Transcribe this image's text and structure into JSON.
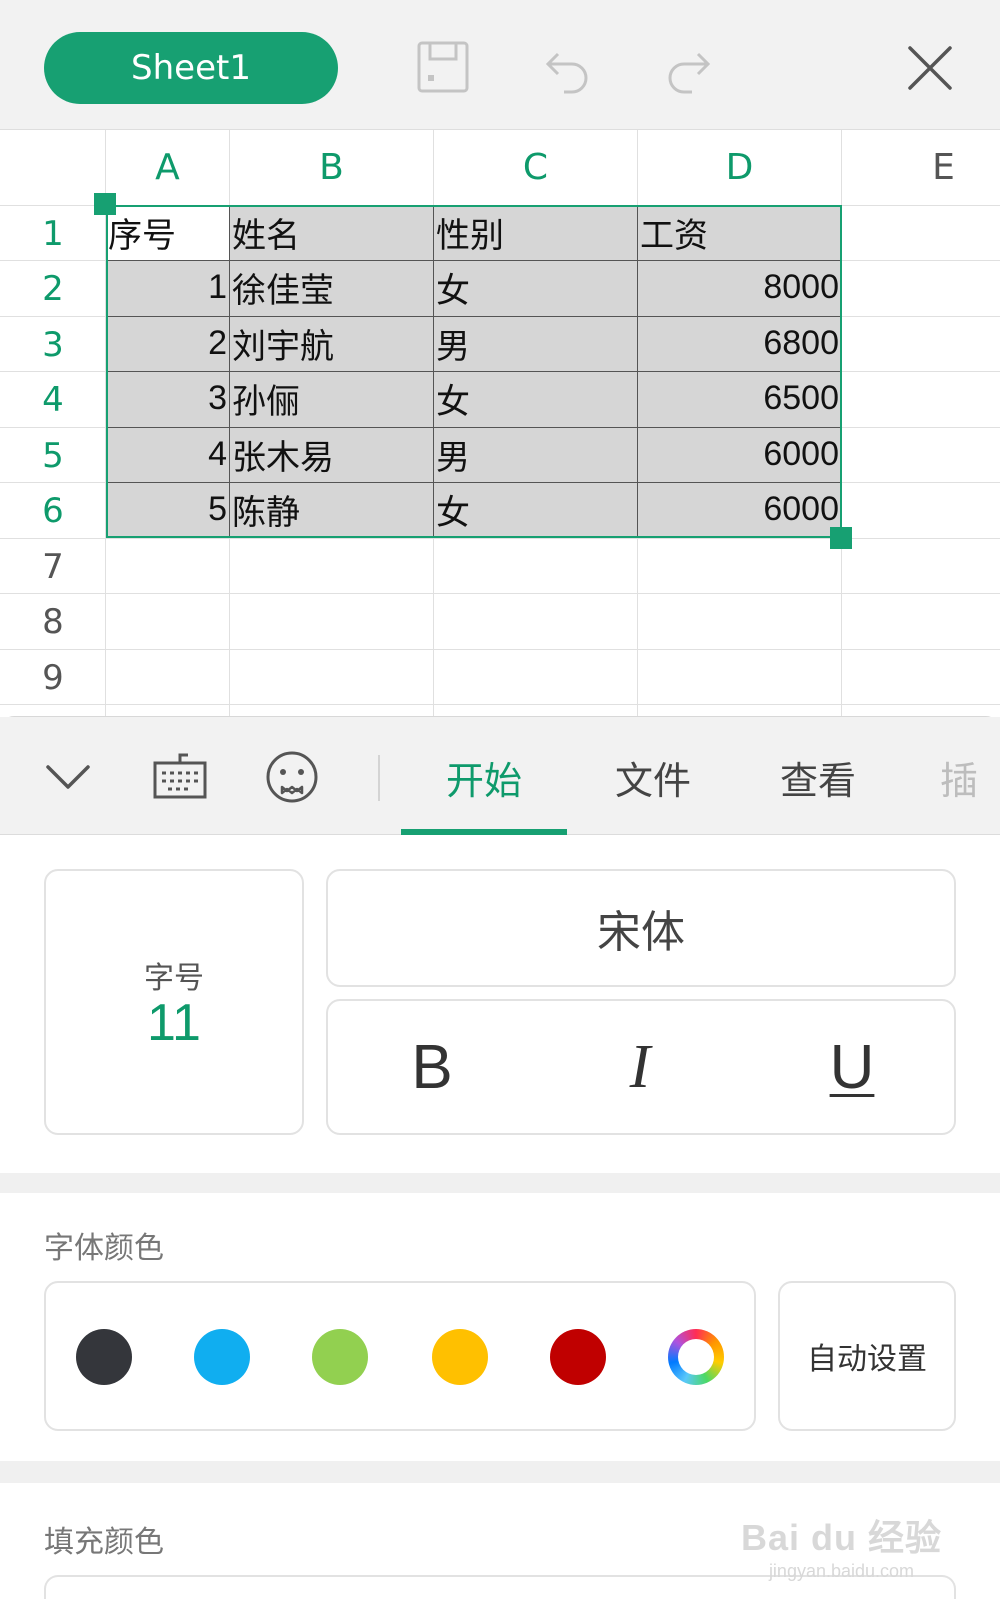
{
  "header": {
    "sheet_tab": "Sheet1",
    "icons": [
      "save-icon",
      "undo-icon",
      "redo-icon",
      "close-icon"
    ]
  },
  "grid": {
    "columns": [
      "A",
      "B",
      "C",
      "D",
      "E"
    ],
    "rows": [
      "1",
      "2",
      "3",
      "4",
      "5",
      "6",
      "7",
      "8",
      "9"
    ],
    "cells": {
      "r1": [
        "序号",
        "姓名",
        "性别",
        "工资"
      ],
      "r2": [
        "1",
        "徐佳莹",
        "女",
        "8000"
      ],
      "r3": [
        "2",
        "刘宇航",
        "男",
        "6800"
      ],
      "r4": [
        "3",
        "孙俪",
        "女",
        "6500"
      ],
      "r5": [
        "4",
        "张木易",
        "男",
        "6000"
      ],
      "r6": [
        "5",
        "陈静",
        "女",
        "6000"
      ]
    }
  },
  "toolbar": {
    "icons": [
      "chevron-down-icon",
      "keyboard-icon",
      "emoji-icon"
    ],
    "tabs": [
      "开始",
      "文件",
      "查看",
      "插"
    ],
    "active_tab": "开始"
  },
  "font": {
    "size_label": "字号",
    "size_value": "11",
    "name": "宋体",
    "bold": "B",
    "italic": "I",
    "underline": "U"
  },
  "font_color": {
    "title": "字体颜色",
    "swatches": [
      "#34363b",
      "#10aef0",
      "#92d050",
      "#ffc000",
      "#c00000"
    ],
    "auto_label": "自动设置"
  },
  "fill_color": {
    "title": "填充颜色"
  },
  "watermark": {
    "main": "Bai du 经验",
    "sub": "jingyan.baidu.com"
  },
  "colors": {
    "accent": "#17a072",
    "selection_fill": "#d6d6d6"
  }
}
